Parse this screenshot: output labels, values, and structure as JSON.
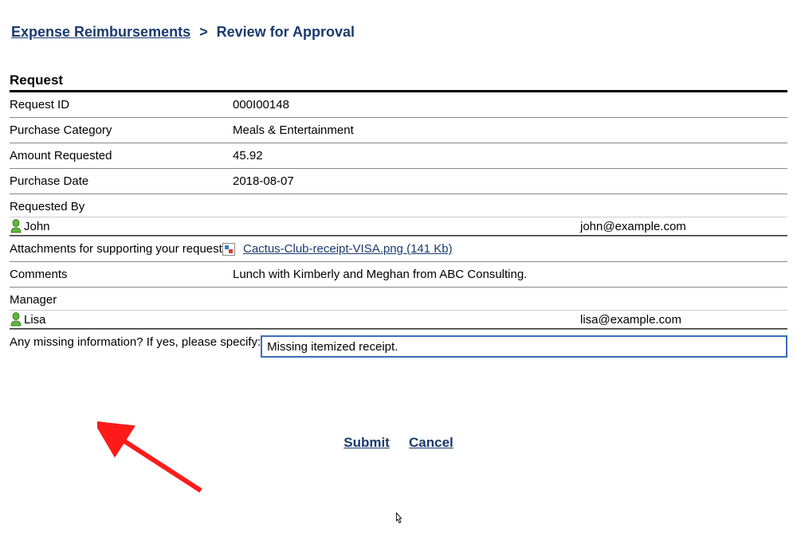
{
  "breadcrumb": {
    "link_text": "Expense Reimbursements",
    "separator": ">",
    "current": "Review for Approval"
  },
  "section_title": "Request",
  "fields": {
    "request_id": {
      "label": "Request ID",
      "value": "000I00148"
    },
    "purchase_category": {
      "label": "Purchase Category",
      "value": "Meals & Entertainment"
    },
    "amount_requested": {
      "label": "Amount Requested",
      "value": "45.92"
    },
    "purchase_date": {
      "label": "Purchase Date",
      "value": "2018-08-07"
    },
    "requested_by": {
      "label": "Requested By",
      "name": "John",
      "email": "john@example.com"
    },
    "attachments": {
      "label": "Attachments for supporting your request",
      "file_text": "Cactus-Club-receipt-VISA.png (141 Kb)"
    },
    "comments": {
      "label": "Comments",
      "value": "Lunch with Kimberly and Meghan from ABC Consulting."
    },
    "manager": {
      "label": "Manager",
      "name": "Lisa",
      "email": "lisa@example.com"
    },
    "missing_info": {
      "label": "Any missing information? If yes, please specify:",
      "value": "Missing itemized receipt."
    }
  },
  "actions": {
    "submit": "Submit",
    "cancel": "Cancel"
  }
}
